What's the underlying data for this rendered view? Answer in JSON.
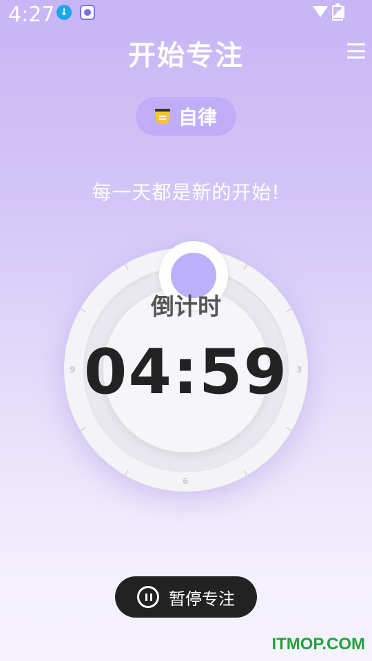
{
  "status_bar": {
    "time": "4:27",
    "download_glyph": "↓"
  },
  "header": {
    "title": "开始专注"
  },
  "category": {
    "label": "自律"
  },
  "motto": "每一天都是新的开始!",
  "timer": {
    "label": "倒计时",
    "value": "04:59"
  },
  "dial": {
    "numbers": {
      "right": "3",
      "bottom": "6",
      "left": "9"
    }
  },
  "controls": {
    "pause_label": "暂停专注"
  },
  "watermark": "ITMOP.COM",
  "colors": {
    "accent": "#bdb0fb",
    "button": "#222222",
    "watermark": "#22a13c"
  }
}
